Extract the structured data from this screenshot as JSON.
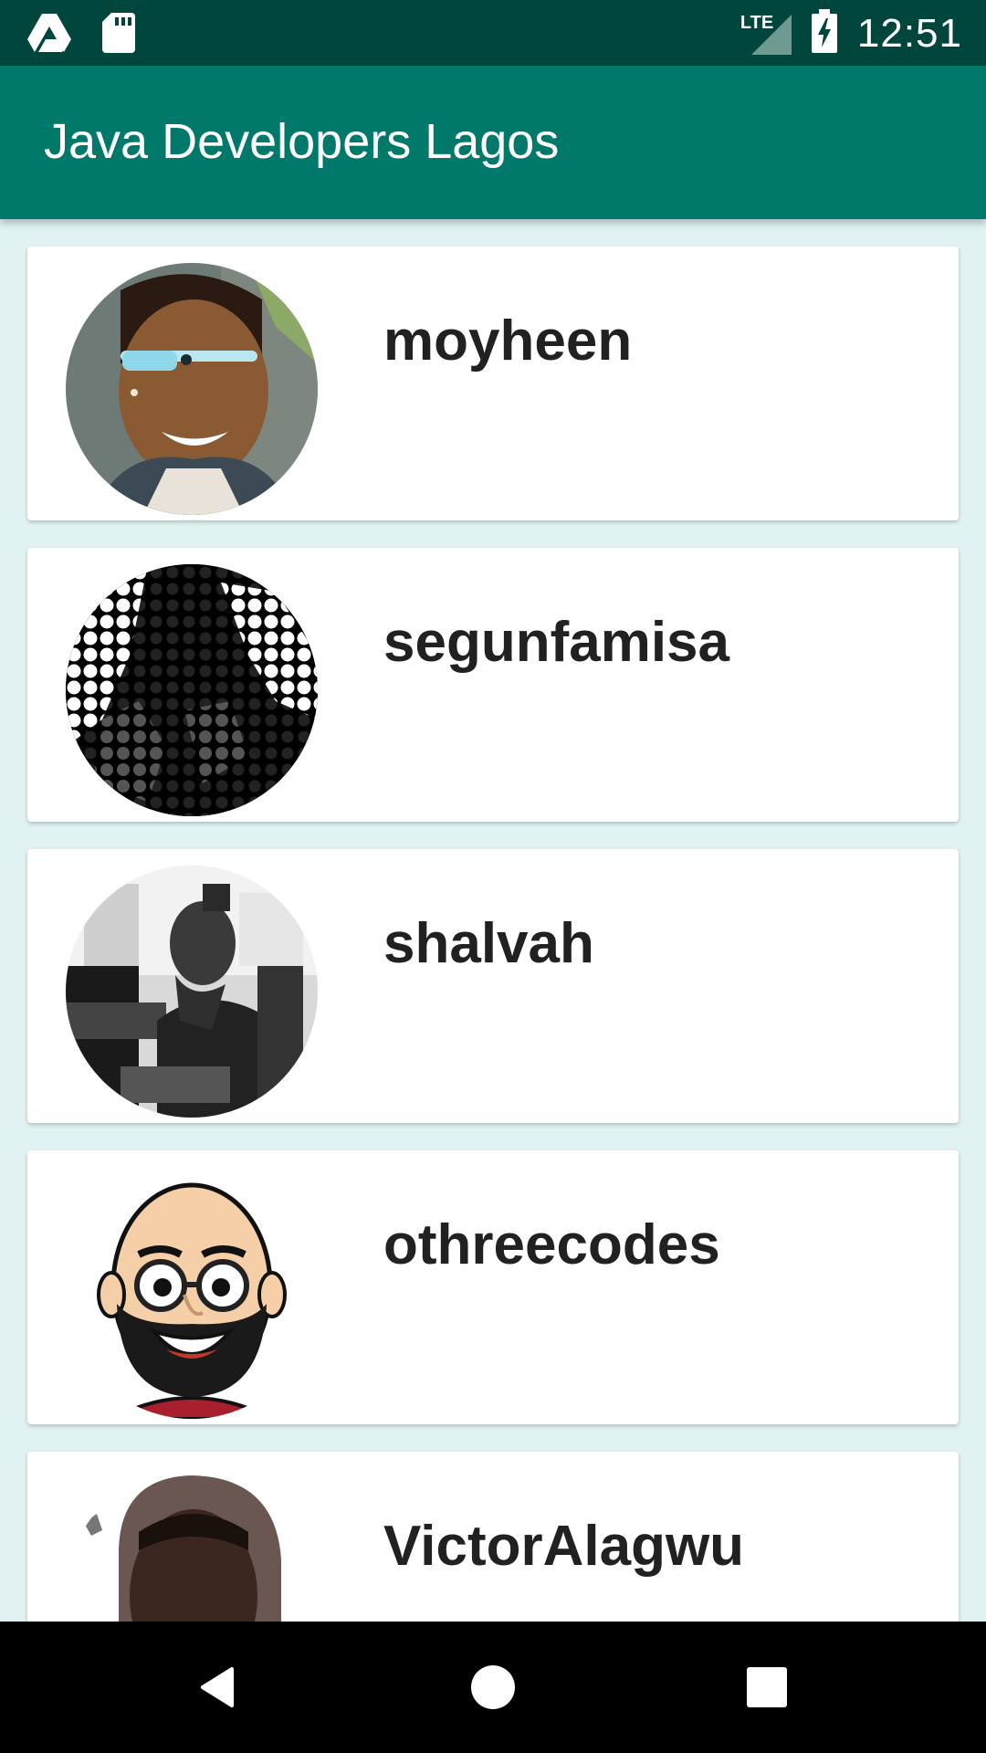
{
  "status_bar": {
    "time": "12:51",
    "network": "LTE",
    "icons": [
      "google-drive-icon",
      "sd-card-icon",
      "lte-signal-icon",
      "battery-charging-icon"
    ]
  },
  "app_bar": {
    "title": "Java Developers Lagos",
    "color": "#00796b"
  },
  "colors": {
    "status_bar": "#00463c",
    "background": "#e0f2f1",
    "card": "#ffffff",
    "username_text": "#212121"
  },
  "developers": [
    {
      "username": "moyheen",
      "avatar": "photo-woman-with-glass"
    },
    {
      "username": "segunfamisa",
      "avatar": "dotted-monochrome-portrait"
    },
    {
      "username": "shalvah",
      "avatar": "bw-photo-man-at-desk"
    },
    {
      "username": "othreecodes",
      "avatar": "cartoon-bearded-man"
    },
    {
      "username": "VictorAlagwu",
      "avatar": "photo-young-man-hood"
    }
  ],
  "nav_bar": {
    "buttons": [
      "back-icon",
      "home-icon",
      "recents-icon"
    ]
  }
}
